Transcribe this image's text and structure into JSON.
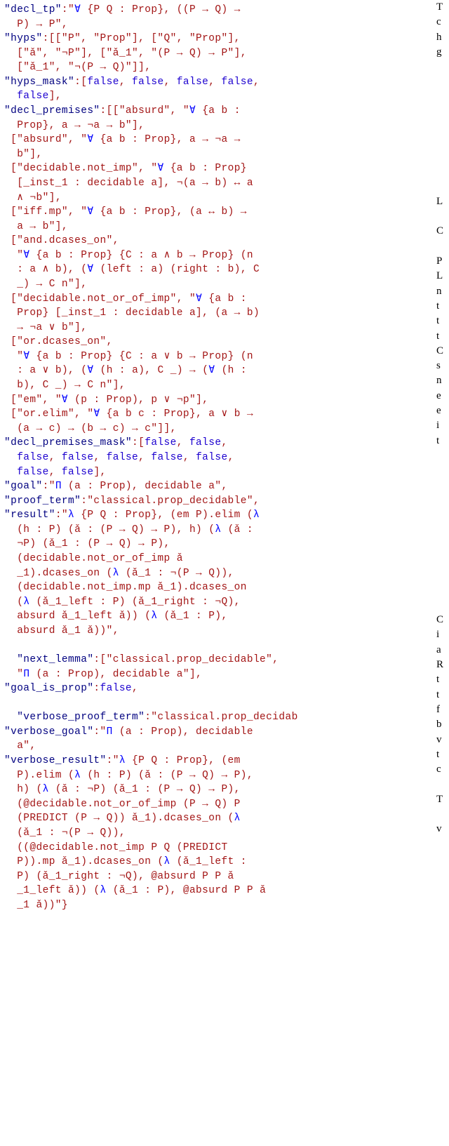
{
  "code": {
    "l01": "\"decl_tp\":\"∀ {P Q : Prop}, ((P → Q) →\n  P) → P\",",
    "l02": "\"hyps\":[[\"P\", \"Prop\"], [\"Q\", \"Prop\"],\n  [\"ǎ\", \"¬P\"], [\"ǎ_1\", \"(P → Q) → P\"],\n  [\"ǎ_1\", \"¬(P → Q)\"]],",
    "l03": "\"hyps_mask\":[false, false, false, false,\n  false],",
    "l04": "\"decl_premises\":[[\"absurd\", \"∀ {a b :\n  Prop}, a → ¬a → b\"],",
    "l05": " [\"absurd\", \"∀ {a b : Prop}, a → ¬a →\n  b\"],",
    "l06": " [\"decidable.not_imp\", \"∀ {a b : Prop}\n  [_inst_1 : decidable a], ¬(a → b) ↔ a\n  ∧ ¬b\"],",
    "l07": " [\"iff.mp\", \"∀ {a b : Prop}, (a ↔ b) →\n  a → b\"],",
    "l08": " [\"and.dcases_on\",\n  \"∀ {a b : Prop} {C : a ∧ b → Prop} (n\n  : a ∧ b), (∀ (left : a) (right : b), C\n  _) → C n\"],",
    "l09": " [\"decidable.not_or_of_imp\", \"∀ {a b :\n  Prop} [_inst_1 : decidable a], (a → b)\n  → ¬a ∨ b\"],",
    "l10": " [\"or.dcases_on\",\n  \"∀ {a b : Prop} {C : a ∨ b → Prop} (n\n  : a ∨ b), (∀ (h : a), C _) → (∀ (h :\n  b), C _) → C n\"],",
    "l11": " [\"em\", \"∀ (p : Prop), p ∨ ¬p\"],",
    "l12": " [\"or.elim\", \"∀ {a b c : Prop}, a ∨ b →\n  (a → c) → (b → c) → c\"]],",
    "l13": "\"decl_premises_mask\":[false, false,\n  false, false, false, false, false,\n  false, false],",
    "l14": "\"goal\":\"Π (a : Prop), decidable a\",",
    "l15": "\"proof_term\":\"classical.prop_decidable\",",
    "l16": "\"result\":\"λ {P Q : Prop}, (em P).elim (λ\n  (h : P) (ǎ : (P → Q) → P), h) (λ (ǎ :\n  ¬P) (ǎ_1 : (P → Q) → P),\n  (decidable.not_or_of_imp ǎ\n  _1).dcases_on (λ (ǎ_1 : ¬(P → Q)),\n  (decidable.not_imp.mp ǎ_1).dcases_on\n  (λ (ǎ_1_left : P) (ǎ_1_right : ¬Q),\n  absurd ǎ_1_left ǎ)) (λ (ǎ_1 : P),\n  absurd ǎ_1 ǎ))\",",
    "gap": "",
    "l17": "  \"next_lemma\":[\"classical.prop_decidable\",\n  \"Π (a : Prop), decidable a\"],",
    "l18": "\"goal_is_prop\":false,",
    "gap2": "",
    "l19": "  \"verbose_proof_term\":\"classical.prop_decidab",
    "l20": "\"verbose_goal\":\"Π (a : Prop), decidable\n  a\",",
    "l21": "\"verbose_result\":\"λ {P Q : Prop}, (em\n  P).elim (λ (h : P) (ǎ : (P → Q) → P),\n  h) (λ (ǎ : ¬P) (ǎ_1 : (P → Q) → P),\n  (@decidable.not_or_of_imp (P → Q) P\n  (PREDICT (P → Q)) ǎ_1).dcases_on (λ\n  (ǎ_1 : ¬(P → Q)),\n  ((@decidable.not_imp P Q (PREDICT\n  P)).mp ǎ_1).dcases_on (λ (ǎ_1_left :\n  P) (ǎ_1_right : ¬Q), @absurd P P ǎ\n  _1_left ǎ)) (λ (ǎ_1 : P), @absurd P P ǎ\n  _1 ǎ))\"}"
  },
  "rightCol": "T\nc\nh\ng\n\n\n\n\n\n\n\n\n\nL\n\nC\n\nP\nL\nn\nt\nt\nt\nC\ns\nn\ne\ne\ni\nt\n\n\n\n\n\n\n\n\n\n\n\nC\ni\na\nR\nt\nt\nf\nb\nv\nt\nc\n\nT\n\nv"
}
